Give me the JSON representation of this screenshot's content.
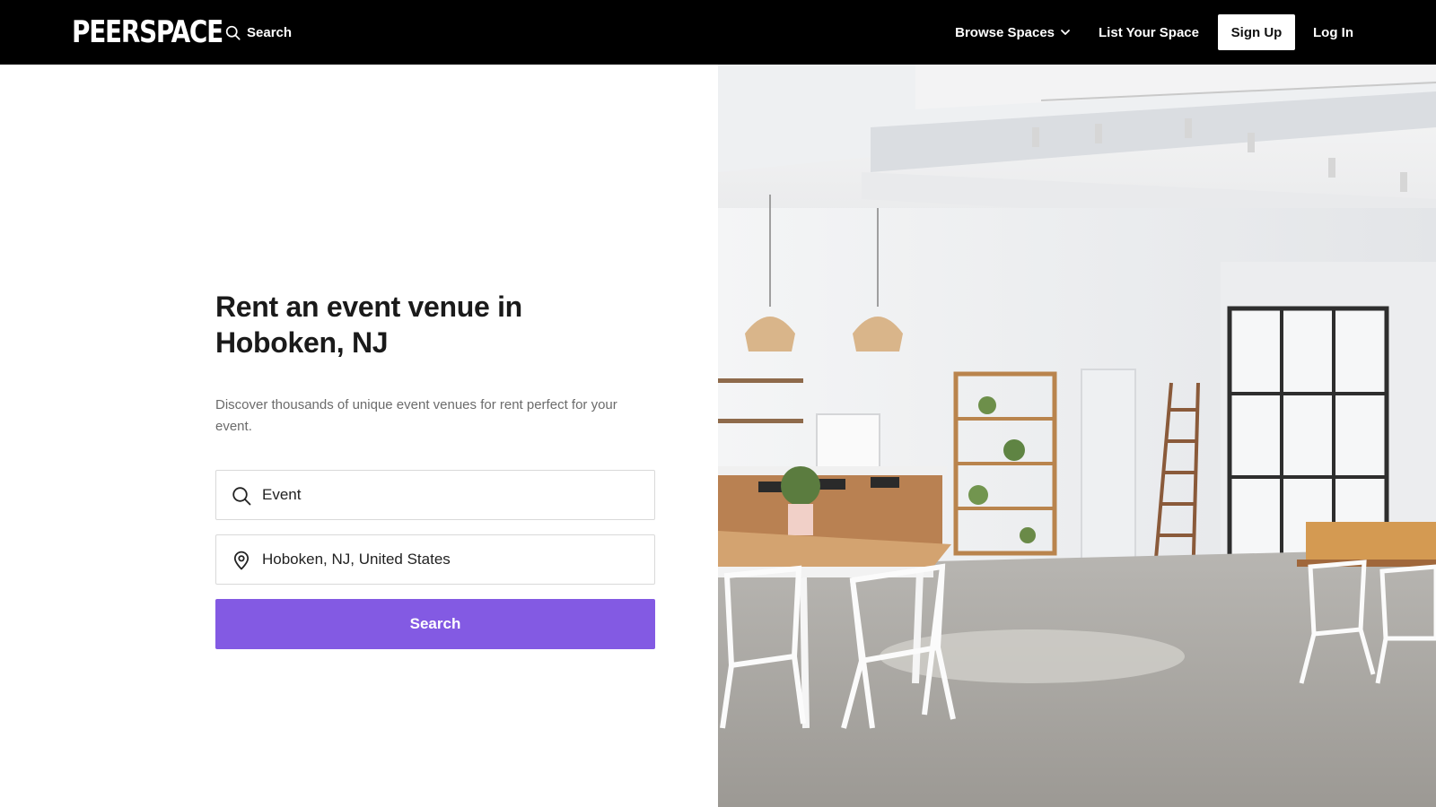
{
  "header": {
    "logo_text": "PEERSPACE",
    "search_label": "Search",
    "browse_label": "Browse Spaces",
    "list_label": "List Your Space",
    "signup_label": "Sign Up",
    "login_label": "Log In"
  },
  "hero": {
    "title": "Rent an event venue in Hoboken, NJ",
    "subtitle": "Discover thousands of unique event venues for rent perfect for your event.",
    "event_field": {
      "value": "Event",
      "icon": "search-icon"
    },
    "location_field": {
      "value": "Hoboken, NJ, United States",
      "icon": "location-pin-icon"
    },
    "search_button": "Search"
  },
  "colors": {
    "header_bg": "#000000",
    "accent": "#835ae3"
  }
}
